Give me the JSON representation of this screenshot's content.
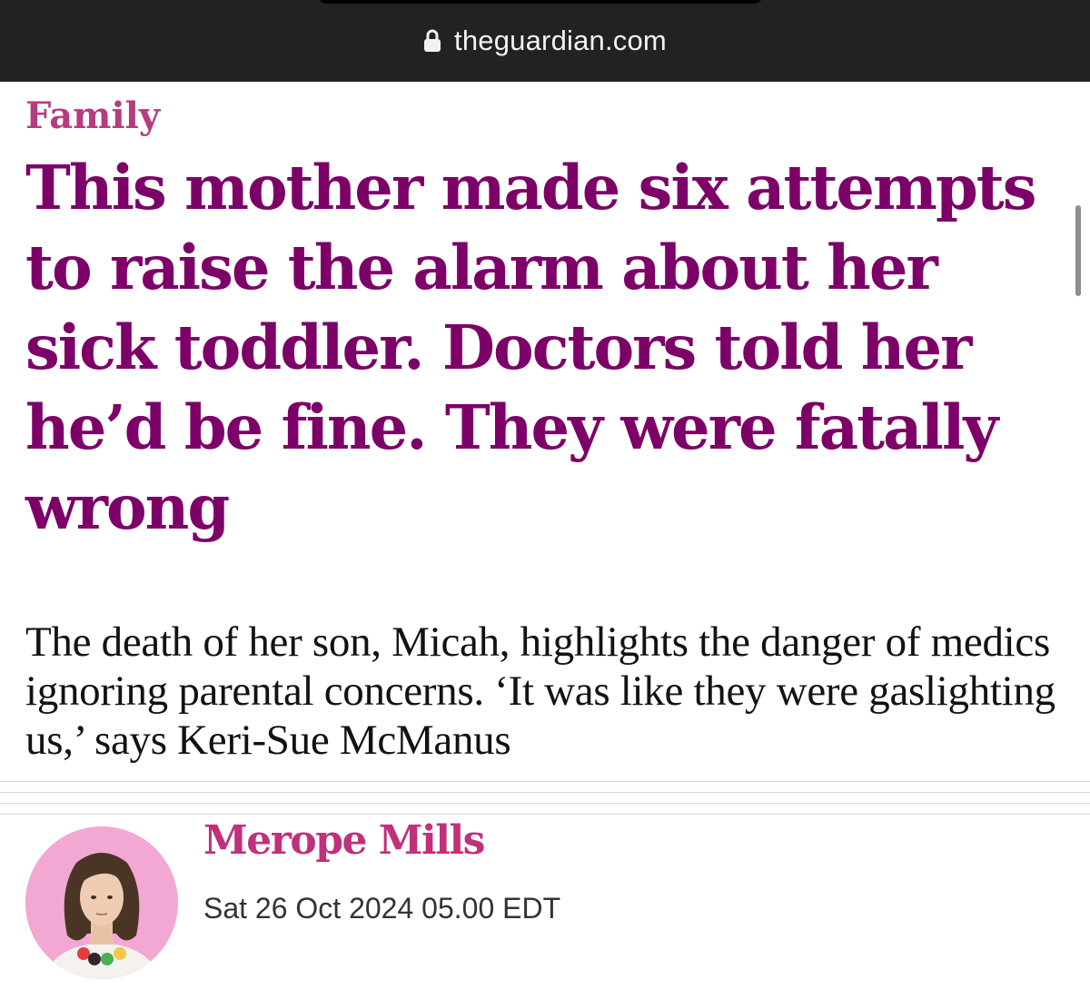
{
  "browser": {
    "url": "theguardian.com",
    "lock_icon": "lock-icon"
  },
  "article": {
    "section": "Family",
    "headline": "This mother made six attempts to raise the alarm about her sick toddler. Doctors told her he’d be fine. They were fatally wrong",
    "standfirst": "The death of her son, Micah, highlights the danger of medics ignoring parental concerns. ‘It was like they were gaslighting us,’ says Keri-Sue McManus",
    "author": "Merope Mills",
    "date": "Sat 26 Oct 2024 05.00 EDT",
    "avatar_icon": "author-photo"
  },
  "colors": {
    "section": "#c74600",
    "headline": "#7d0068",
    "byline": "#c0307b",
    "avatar_bg": "#f3a8d4",
    "url_bar": "#222222"
  }
}
